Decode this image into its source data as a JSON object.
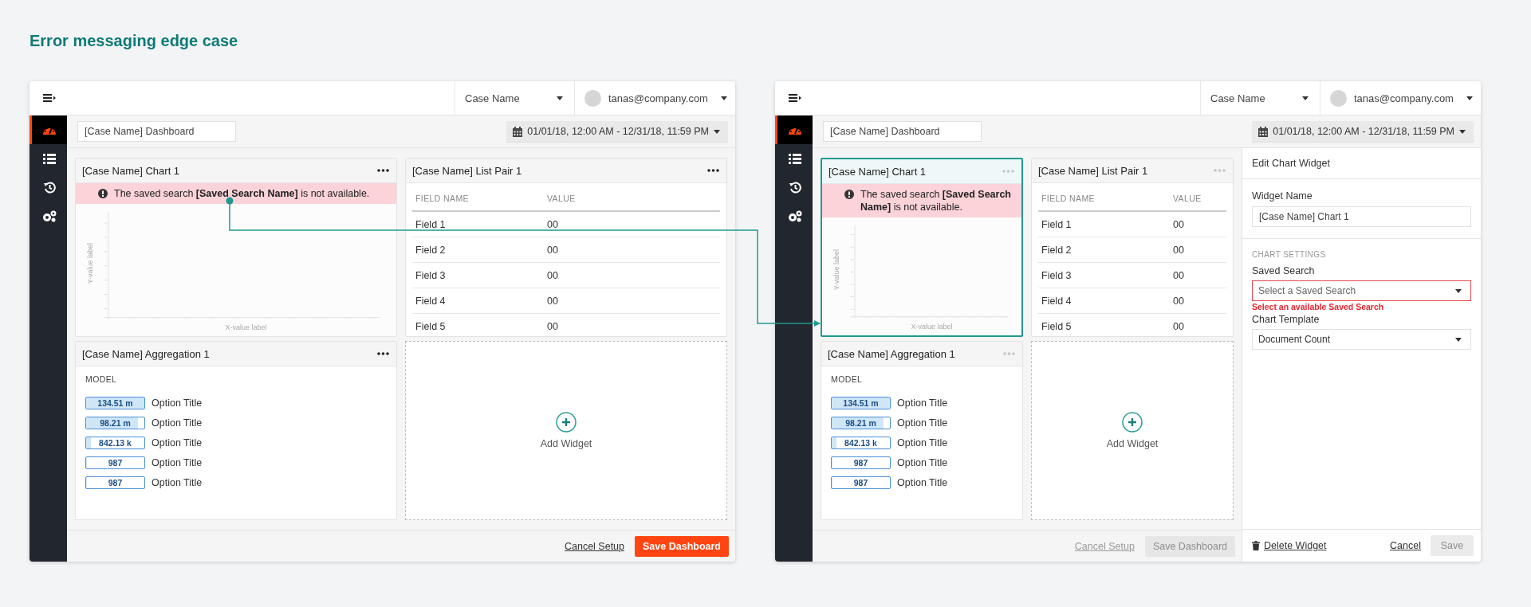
{
  "page_title": "Error messaging edge case",
  "screens": [
    {
      "case_select": "Case Name",
      "user": "tanas@company.com",
      "sidebar": [
        {
          "selected": true
        },
        {
          "selected": false
        },
        {
          "selected": false
        },
        {
          "selected": false
        }
      ],
      "dashboard_name": "[Case Name] Dashboard",
      "date_range": "01/01/18, 12:00 AM - 12/31/18, 11:59 PM",
      "chart_widget": {
        "title": "[Case Name] Chart 1",
        "selected": false,
        "menu_disabled": false,
        "error": "The saved search **[Saved Search Name]** is not available.",
        "ylabel": "Y-value label",
        "xlabel": "X-value label"
      },
      "list_widget": {
        "title": "[Case Name] List Pair 1",
        "menu_disabled": false,
        "columns": [
          "FIELD NAME",
          "VALUE"
        ],
        "rows": [
          [
            "Field 1",
            "00"
          ],
          [
            "Field 2",
            "00"
          ],
          [
            "Field 3",
            "00"
          ],
          [
            "Field 4",
            "00"
          ],
          [
            "Field 5",
            "00"
          ]
        ]
      },
      "aggregation_widget": {
        "title": "[Case Name] Aggregation 1",
        "menu_disabled": false,
        "heading": "MODEL",
        "items": [
          {
            "value": "134.51 m",
            "label": "Option Title",
            "level": 1
          },
          {
            "value": "98.21 m",
            "label": "Option Title",
            "level": 0.88
          },
          {
            "value": "842.13 k",
            "label": "Option Title",
            "level": 0.07
          },
          {
            "value": "987",
            "label": "Option Title",
            "level": 0
          },
          {
            "value": "987",
            "label": "Option Title",
            "level": 0
          }
        ]
      },
      "add_widget": "Add Widget",
      "footer": {
        "cancel": {
          "label": "Cancel Setup",
          "disabled": false
        },
        "save": {
          "label": "Save Dashboard",
          "disabled": false
        }
      }
    },
    {
      "case_select": "Case Name",
      "user": "tanas@company.com",
      "sidebar": [
        {
          "selected": true
        },
        {
          "selected": false
        },
        {
          "selected": false
        },
        {
          "selected": false
        }
      ],
      "dashboard_name": "[Case Name] Dashboard",
      "date_range": "01/01/18, 12:00 AM - 12/31/18, 11:59 PM",
      "chart_widget": {
        "title": "[Case Name] Chart 1",
        "selected": true,
        "menu_disabled": true,
        "error": "The saved search **[Saved Search Name]** is not available.",
        "ylabel": "Y-value label",
        "xlabel": "X-value label"
      },
      "list_widget": {
        "title": "[Case Name] List Pair 1",
        "menu_disabled": true,
        "columns": [
          "FIELD NAME",
          "VALUE"
        ],
        "rows": [
          [
            "Field 1",
            "00"
          ],
          [
            "Field 2",
            "00"
          ],
          [
            "Field 3",
            "00"
          ],
          [
            "Field 4",
            "00"
          ],
          [
            "Field 5",
            "00"
          ]
        ]
      },
      "aggregation_widget": {
        "title": "[Case Name] Aggregation 1",
        "menu_disabled": true,
        "heading": "MODEL",
        "items": [
          {
            "value": "134.51 m",
            "label": "Option Title",
            "level": 1
          },
          {
            "value": "98.21 m",
            "label": "Option Title",
            "level": 0.88
          },
          {
            "value": "842.13 k",
            "label": "Option Title",
            "level": 0.07
          },
          {
            "value": "987",
            "label": "Option Title",
            "level": 0
          },
          {
            "value": "987",
            "label": "Option Title",
            "level": 0
          }
        ]
      },
      "add_widget": "Add Widget",
      "footer": {
        "cancel": {
          "label": "Cancel Setup",
          "disabled": true
        },
        "save": {
          "label": "Save Dashboard",
          "disabled": true
        }
      },
      "edit_panel": {
        "title": "Edit Chart Widget",
        "name_label": "Widget Name",
        "name_value": "[Case Name] Chart 1",
        "section": "CHART SETTINGS",
        "search_label": "Saved Search",
        "search_placeholder": "Select a Saved Search",
        "search_error": "Select an available Saved Search",
        "template_label": "Chart Template",
        "template_value": "Document Count",
        "delete": "Delete Widget",
        "cancel": "Cancel",
        "save": {
          "label": "Save",
          "disabled": true
        }
      }
    }
  ]
}
